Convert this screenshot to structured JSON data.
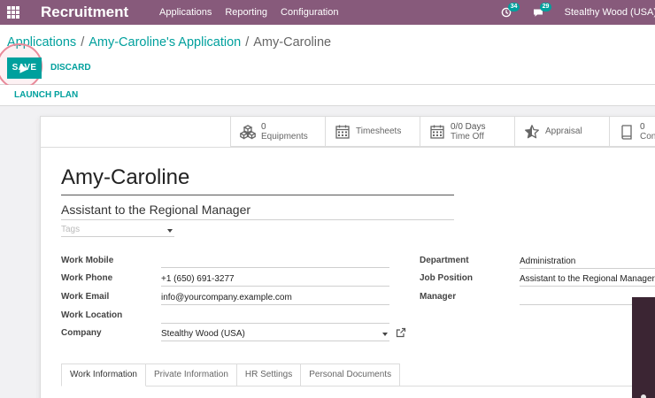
{
  "navbar": {
    "app_name": "Recruitment",
    "menu": [
      "Applications",
      "Reporting",
      "Configuration"
    ],
    "activity_count": "34",
    "message_count": "29",
    "company": "Stealthy Wood (USA)"
  },
  "breadcrumb": {
    "root": "Applications",
    "parent": "Amy-Caroline's Application",
    "current": "Amy-Caroline",
    "separator": "/"
  },
  "actions": {
    "save_label": "SAVE",
    "discard_label": "DISCARD",
    "launch_plan_label": "LAUNCH PLAN"
  },
  "smart_buttons": {
    "equipments_count": "0",
    "equipments_label": "Equipments",
    "timesheets_label": "Timesheets",
    "timeoff_value": "0/0 Days",
    "timeoff_label": "Time Off",
    "appraisal_label": "Appraisal",
    "contracts_count": "0",
    "contracts_label": "Con"
  },
  "employee": {
    "name": "Amy-Caroline",
    "job_title": "Assistant to the Regional Manager",
    "tags_placeholder": "Tags"
  },
  "left_fields": {
    "work_mobile_label": "Work Mobile",
    "work_mobile": "",
    "work_phone_label": "Work Phone",
    "work_phone": "+1 (650) 691-3277",
    "work_email_label": "Work Email",
    "work_email": "info@yourcompany.example.com",
    "work_location_label": "Work Location",
    "work_location": "",
    "company_label": "Company",
    "company": "Stealthy Wood (USA)"
  },
  "right_fields": {
    "department_label": "Department",
    "department": "Administration",
    "job_position_label": "Job Position",
    "job_position": "Assistant to the Regional Manager",
    "manager_label": "Manager",
    "manager": ""
  },
  "tabs": [
    "Work Information",
    "Private Information",
    "HR Settings",
    "Personal Documents"
  ],
  "colors": {
    "navbar": "#875a7b",
    "primary": "#00a09d",
    "click_ring": "#e88a9a"
  }
}
